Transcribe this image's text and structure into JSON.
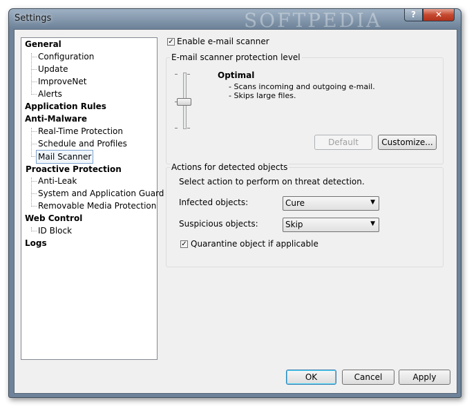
{
  "window": {
    "title": "Settings",
    "watermark": "SOFTPEDIA"
  },
  "titlebar": {
    "help_label": "?",
    "close_label": "✕"
  },
  "tree": {
    "items": [
      {
        "label": "General",
        "level": 0
      },
      {
        "label": "Configuration",
        "level": 1
      },
      {
        "label": "Update",
        "level": 1
      },
      {
        "label": "ImproveNet",
        "level": 1
      },
      {
        "label": "Alerts",
        "level": 1
      },
      {
        "label": "Application Rules",
        "level": 0
      },
      {
        "label": "Anti-Malware",
        "level": 0
      },
      {
        "label": "Real-Time Protection",
        "level": 1
      },
      {
        "label": "Schedule and Profiles",
        "level": 1
      },
      {
        "label": "Mail Scanner",
        "level": 1,
        "selected": true
      },
      {
        "label": "Proactive Protection",
        "level": 0
      },
      {
        "label": "Anti-Leak",
        "level": 1
      },
      {
        "label": "System and Application Guard",
        "level": 1
      },
      {
        "label": "Removable Media Protection",
        "level": 1
      },
      {
        "label": "Web Control",
        "level": 0
      },
      {
        "label": "ID Block",
        "level": 1
      },
      {
        "label": "Logs",
        "level": 0
      }
    ]
  },
  "mail_scanner": {
    "enable_label": "Enable e-mail scanner",
    "enable_checked": true,
    "protection_group_title": "E-mail scanner protection level",
    "level_name": "Optimal",
    "level_desc_1": "- Scans incoming and outgoing e-mail.",
    "level_desc_2": "- Skips large files.",
    "default_button": "Default",
    "customize_button": "Customize...",
    "actions_group_title": "Actions for detected objects",
    "actions_instruction": "Select action to perform on threat detection.",
    "infected_label": "Infected objects:",
    "infected_value": "Cure",
    "suspicious_label": "Suspicious objects:",
    "suspicious_value": "Skip",
    "quarantine_label": "Quarantine object if applicable",
    "quarantine_checked": true,
    "checkmark": "✓",
    "dropdown_arrow": "▼"
  },
  "footer": {
    "ok": "OK",
    "cancel": "Cancel",
    "apply": "Apply"
  },
  "colors": {
    "titlebar": "#6e8399",
    "close": "#c5482f",
    "selection_border": "#7da2ce"
  }
}
